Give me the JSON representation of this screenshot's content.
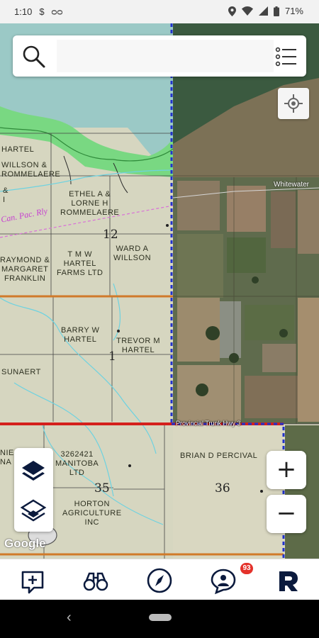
{
  "status_bar": {
    "time": "1:10",
    "battery": "71%"
  },
  "search": {
    "placeholder": ""
  },
  "map": {
    "owners": [
      "HARTEL",
      "WILLSON &\nROMMELAERE",
      "&\nI",
      "ETHEL A &\nLORNE H\nROMMELAERE",
      "RAYMOND &\nMARGARET\nFRANKLIN",
      "T M W\nHARTEL\nFARMS LTD",
      "WARD A\nWILLSON",
      "BARRY W\nHARTEL",
      "TREVOR M\nHARTEL",
      "SUNAERT",
      "NIE\nNA",
      "3262421\nMANITOBA\nLTD",
      "HORTON\nAGRICULTURE\nINC",
      "BRIAN D PERCIVAL"
    ],
    "sections": [
      "12",
      "1",
      "35",
      "36"
    ],
    "rail_label": "Can. Pac. Rly",
    "place_label": "Whitewater",
    "highway_label": "Provincial Trunk Hwy 3",
    "attribution": "Google"
  },
  "zoom": {
    "in_label": "+",
    "out_label": "−"
  },
  "nav": {
    "badge_count": "93"
  },
  "colors": {
    "accent": "#0b1a3d",
    "badge": "#e4322b",
    "highway": "#d4201c",
    "boundary": "#2233cc",
    "road": "#d07a2a",
    "water_green": "#79d882"
  }
}
